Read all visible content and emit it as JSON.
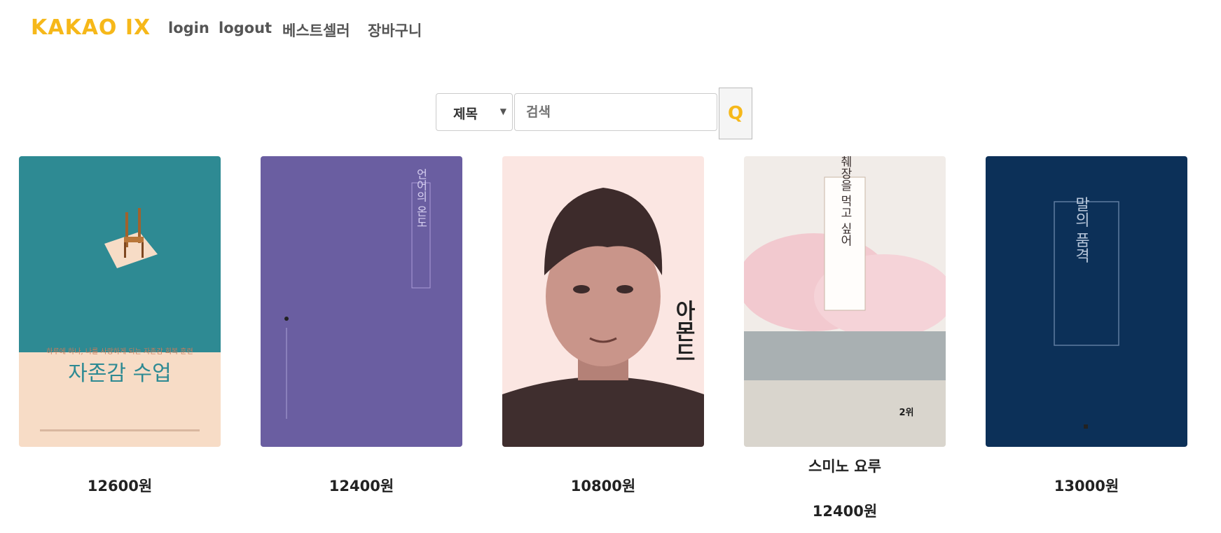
{
  "header": {
    "logo": "KAKAO IX",
    "links": [
      "login",
      "logout",
      "베스트셀러",
      "장바구니"
    ]
  },
  "search": {
    "select_value": "제목",
    "placeholder": "검색",
    "button_label": "Q"
  },
  "colors": {
    "accent": "#f6b81a"
  },
  "books": [
    {
      "title": "",
      "price": "12600원",
      "cover_text": "자존감 수업",
      "cover_subtitle": "하루에 하나, 나를 사랑하게 되는 자존감 회복 훈련"
    },
    {
      "title": "",
      "price": "12400원",
      "cover_text": "언어의 온도"
    },
    {
      "title": "",
      "price": "10800원",
      "cover_text": "아몬드"
    },
    {
      "title": "스미노 요루",
      "price": "12400원",
      "cover_text": "너의 췌장을 먹고 싶어",
      "cover_badge": "2위"
    },
    {
      "title": "",
      "price": "13000원",
      "cover_text": "말의 품격"
    }
  ]
}
